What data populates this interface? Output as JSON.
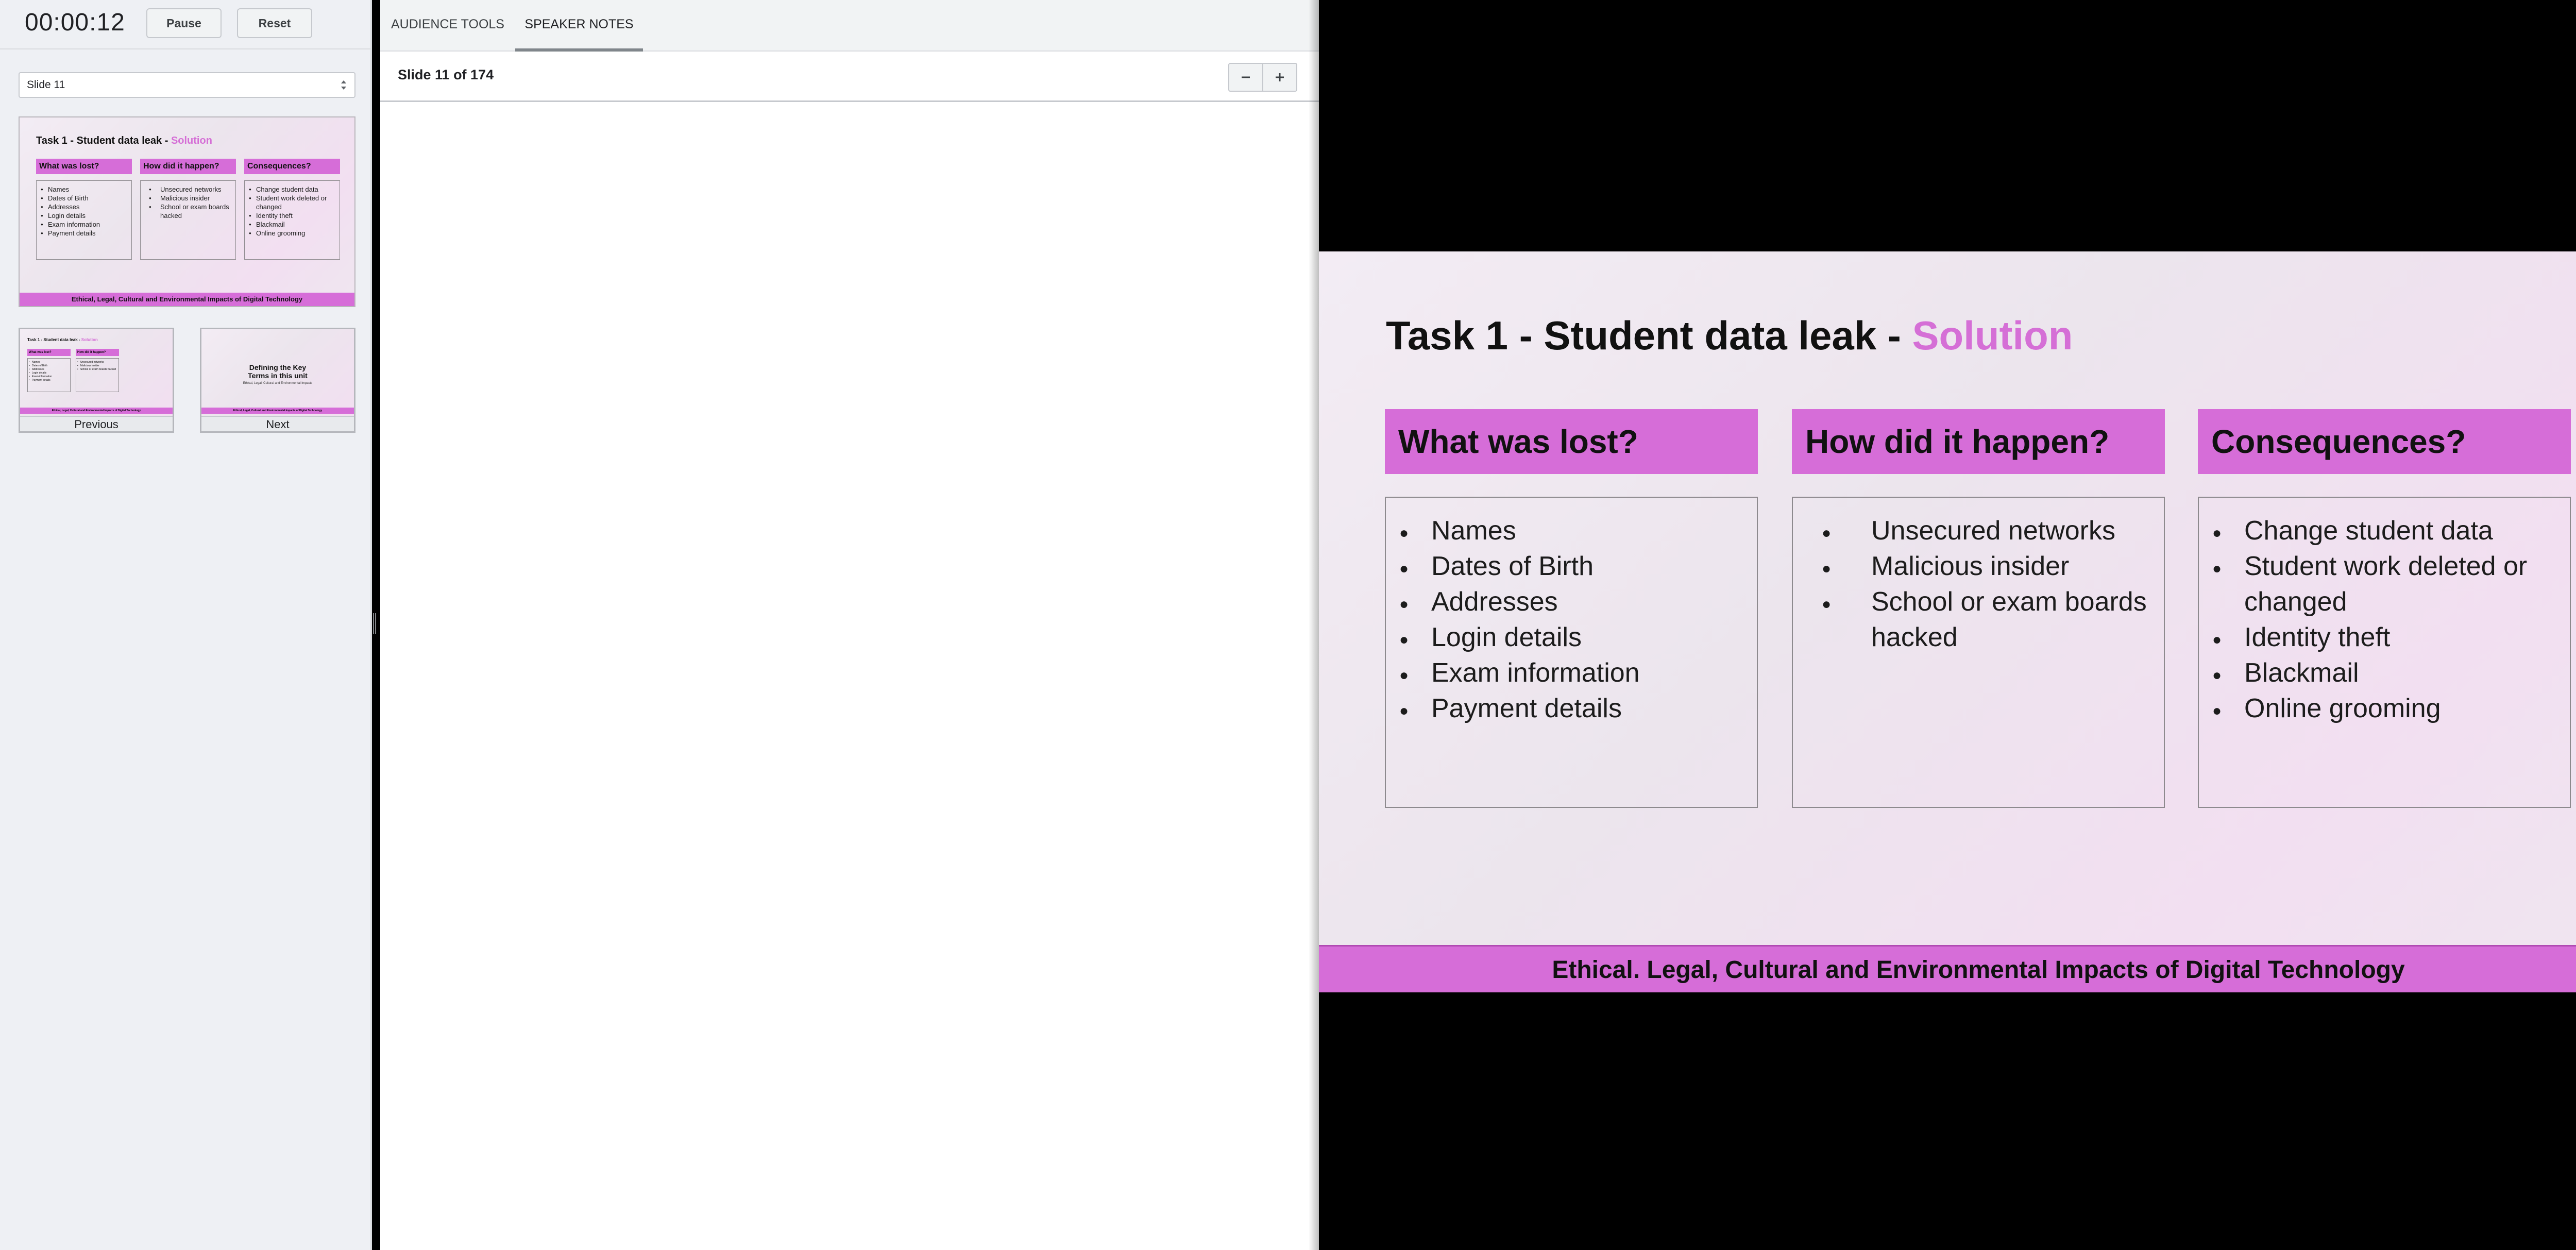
{
  "timer": {
    "time": "00:00:12",
    "pause_label": "Pause",
    "reset_label": "Reset"
  },
  "slide_select": {
    "value": "Slide 11"
  },
  "navigation": {
    "previous_label": "Previous",
    "next_label": "Next"
  },
  "tabs": {
    "audience_tools": "AUDIENCE TOOLS",
    "speaker_notes": "SPEAKER NOTES"
  },
  "notes": {
    "slide_counter": "Slide 11 of 174",
    "zoom_out": "−",
    "zoom_in": "+"
  },
  "colors": {
    "accent": "#d66dd8",
    "timer_bg": "#eef0f4"
  },
  "current_slide": {
    "title_main": "Task 1 - Student data leak - ",
    "title_accent": "Solution",
    "columns": [
      {
        "heading": "What was lost?",
        "items": [
          "Names",
          "Dates of Birth",
          "Addresses",
          "Login details",
          "Exam information",
          "Payment details"
        ]
      },
      {
        "heading": "How did it happen?",
        "items": [
          "Unsecured networks",
          "Malicious insider",
          "School or exam boards hacked"
        ]
      },
      {
        "heading": "Consequences?",
        "items": [
          "Change student data",
          "Student work deleted or changed",
          "Identity theft",
          "Blackmail",
          "Online grooming"
        ]
      }
    ],
    "footer": "Ethical. Legal, Cultural and Environmental Impacts of Digital Technology"
  },
  "thumb_footer": "Ethical, Legal, Cultural and Environmental Impacts of Digital Technology",
  "previous_slide": {
    "title_main": "Task 1 - Student data leak - ",
    "title_accent": "Solution",
    "columns": [
      {
        "heading": "What was lost?",
        "items": [
          "Names",
          "Dates of Birth",
          "Addresses",
          "Login details",
          "Exam information",
          "Payment details"
        ]
      },
      {
        "heading": "How did it happen?",
        "items": [
          "Unsecured networks",
          "Malicious insider",
          "School or exam boards hacked"
        ]
      }
    ],
    "footer": "Ethical, Legal, Cultural and Environmental Impacts of Digital Technology"
  },
  "next_slide": {
    "title": "Defining the Key Terms in this unit",
    "subtitle": "Ethical, Legal, Cultural and Environmental Impacts",
    "footer": "Ethical, Legal, Cultural and Environmental Impacts of Digital Technology"
  }
}
